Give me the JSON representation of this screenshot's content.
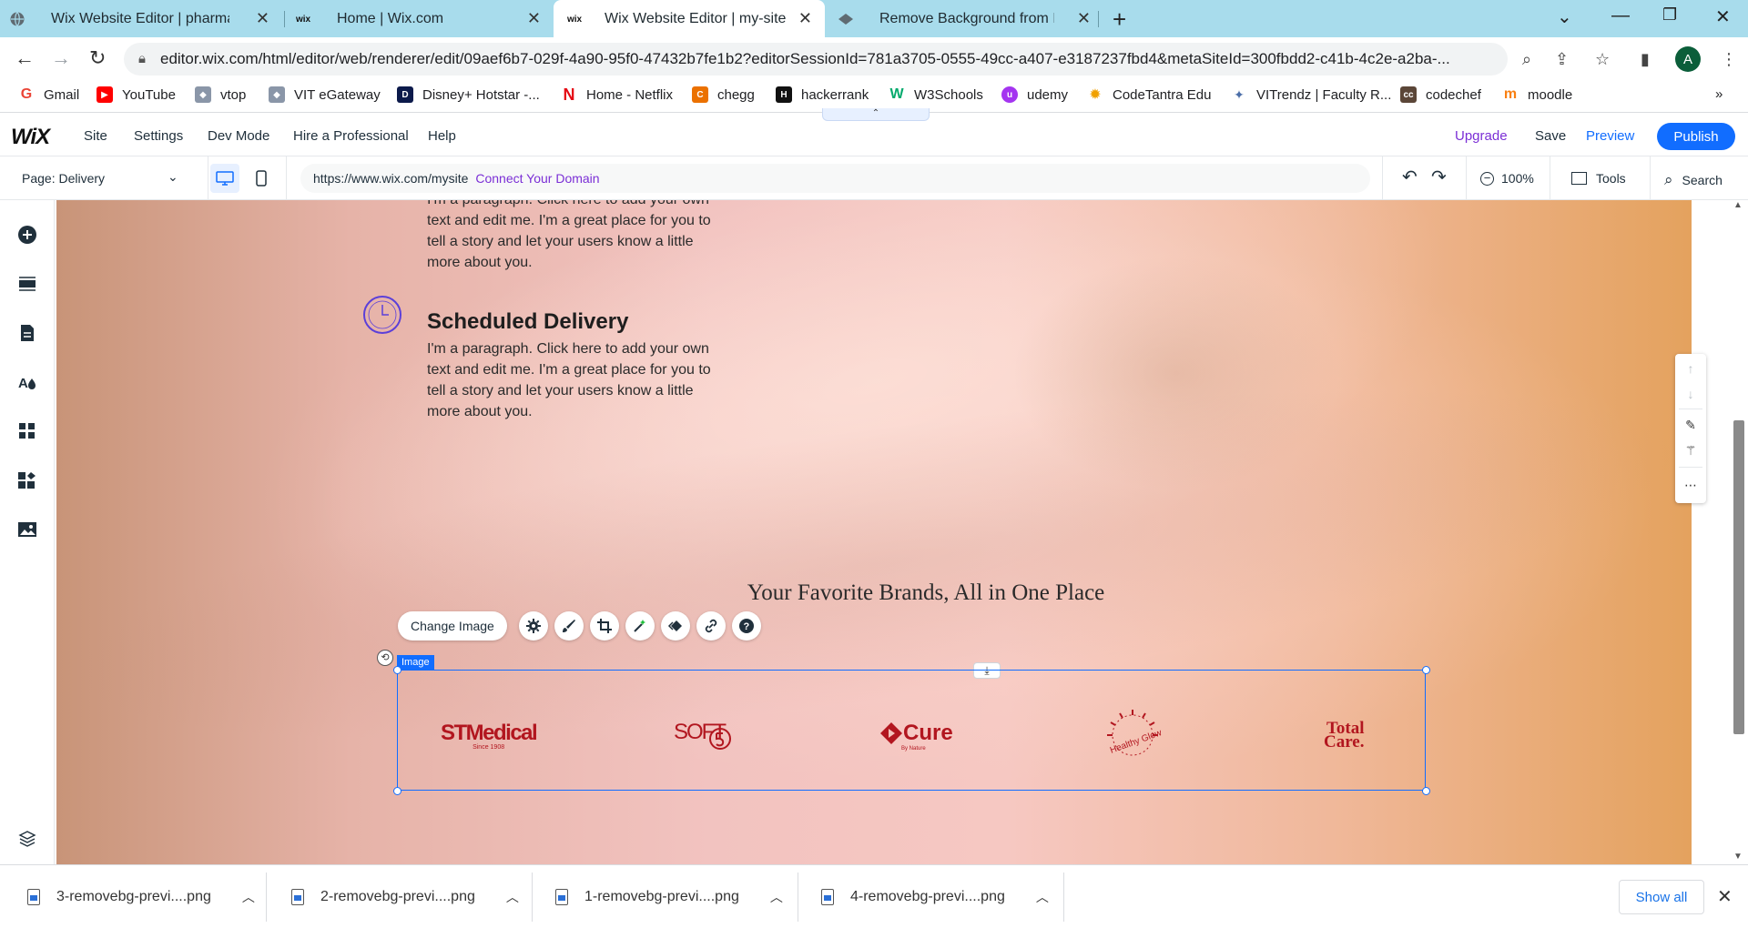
{
  "browser": {
    "tabs": [
      {
        "title": "Wix Website Editor | pharmacy-a",
        "favicon": "globe-icon"
      },
      {
        "title": "Home | Wix.com",
        "favicon": "wix-icon"
      },
      {
        "title": "Wix Website Editor | my-site",
        "favicon": "wix-icon",
        "active": true
      },
      {
        "title": "Remove Background from Image",
        "favicon": "removebg-icon"
      }
    ],
    "url": "editor.wix.com/html/editor/web/renderer/edit/09aef6b7-029f-4a90-95f0-47432b7fe1b2?editorSessionId=781a3705-0555-49cc-a407-e3187237fbd4&metaSiteId=300fbdd2-c41b-4c2e-a2ba-...",
    "profile_initial": "A",
    "bookmarks": [
      "Gmail",
      "YouTube",
      "vtop",
      "VIT eGateway",
      "Disney+ Hotstar -...",
      "Home - Netflix",
      "chegg",
      "hackerrank",
      "W3Schools",
      "udemy",
      "CodeTantra Edu",
      "VITrendz | Faculty R...",
      "codechef",
      "moodle"
    ],
    "bookmarks_overflow": "»"
  },
  "wix": {
    "logo": "WiX",
    "menu": [
      "Site",
      "Settings",
      "Dev Mode",
      "Hire a Professional",
      "Help"
    ],
    "upgrade": "Upgrade",
    "save": "Save",
    "preview": "Preview",
    "publish": "Publish",
    "collapse_glyph": "⌃",
    "page_selector": "Page: Delivery",
    "site_url": "https://www.wix.com/mysite",
    "connect_domain": "Connect Your Domain",
    "zoom": "100%",
    "tools": "Tools",
    "search": "Search"
  },
  "canvas": {
    "para_top": "I'm a paragraph. Click here to add your own text and edit me. I'm a great place for you to tell a story and let your users know a little more about you.",
    "heading": "Scheduled Delivery",
    "para_bottom": "I'm a paragraph. Click here to add your own text and edit me. I'm a great place for you to tell a story and let your users know a little more about you.",
    "brands_title": "Your Favorite Brands, All in One Place",
    "change_image": "Change Image",
    "selection_label": "Image",
    "brands": {
      "st": "STMedical",
      "st_sub": "Since 1908",
      "soft": "SOFT",
      "cure": "Cure",
      "cure_sub": "By Nature",
      "glow": "Healthy Glow",
      "total1": "Total",
      "total2": "Care."
    }
  },
  "downloads": {
    "items": [
      "3-removebg-previ....png",
      "2-removebg-previ....png",
      "1-removebg-previ....png",
      "4-removebg-previ....png"
    ],
    "show_all": "Show all"
  },
  "colors": {
    "tabstrip": "#a8dcec",
    "wix_blue": "#116dff",
    "connect_purple": "#7b2fd6",
    "brand_red": "#b2161f"
  }
}
